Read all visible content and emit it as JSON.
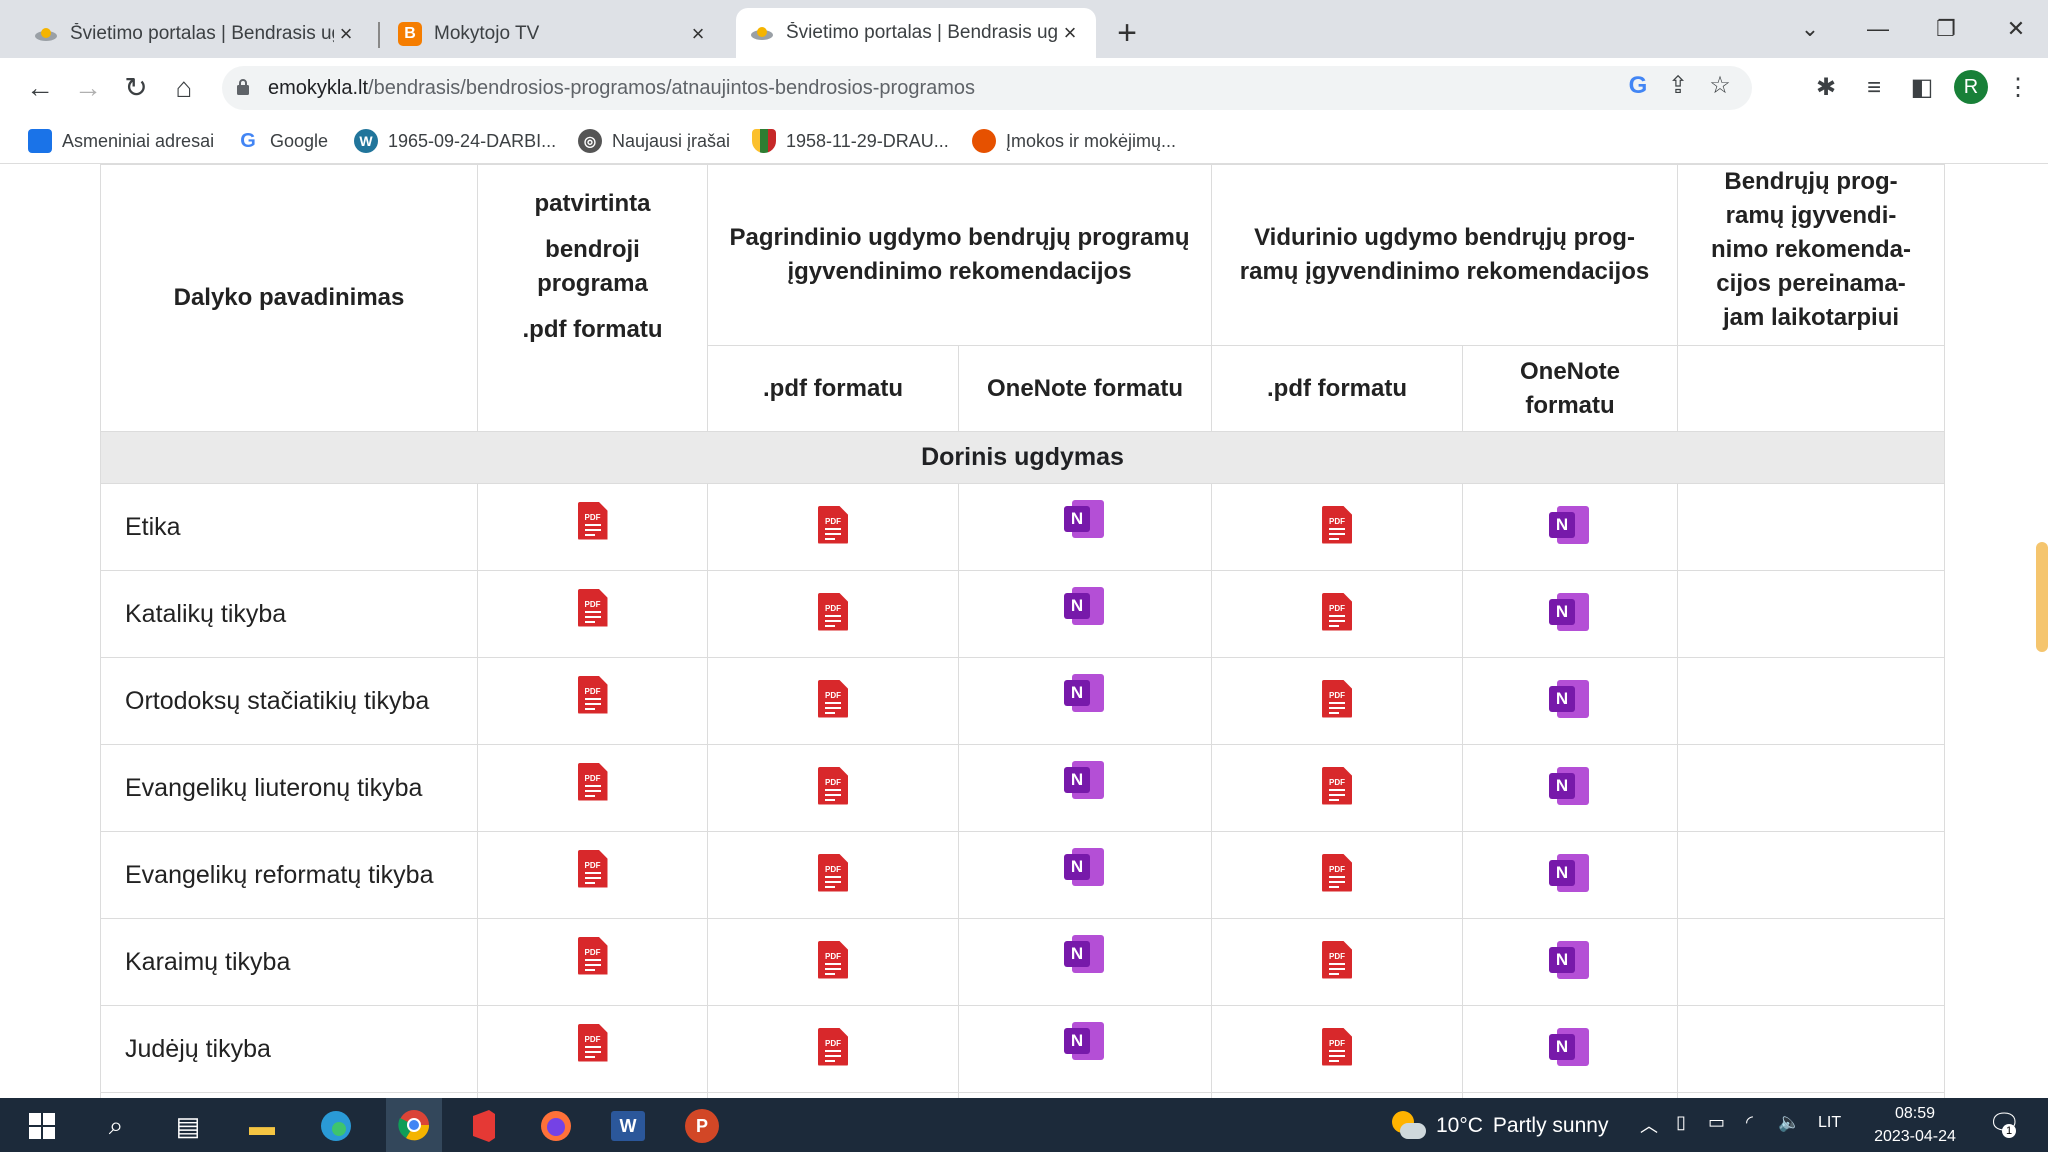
{
  "tabs": [
    {
      "title": "Švietimo portalas | Bendrasis ugd",
      "icon": "portal-icon",
      "active": false
    },
    {
      "title": "Mokytojo TV",
      "icon": "blogger-icon",
      "active": false
    },
    {
      "title": "Švietimo portalas | Bendrasis ugd",
      "icon": "portal-icon",
      "active": true
    }
  ],
  "address": {
    "host": "emokykla.lt",
    "path": "/bendrasis/bendrosios-programos/atnaujintos-bendrosios-programos"
  },
  "bookmarks": [
    {
      "label": "Asmeniniai adresai",
      "icon": "folder-icon",
      "color": "#1a73e8"
    },
    {
      "label": "Google",
      "icon": "google-icon",
      "color": "#4285f4"
    },
    {
      "label": "1965-09-24-DARBI...",
      "icon": "wordpress-icon",
      "color": "#21759b"
    },
    {
      "label": "Naujausi įrašai",
      "icon": "globe-icon",
      "color": "#555"
    },
    {
      "label": "1958-11-29-DRAU...",
      "icon": "shield-icon",
      "color": "#2e7d32"
    },
    {
      "label": "Įmokos ir mokėjimų...",
      "icon": "payments-icon",
      "color": "#e65100"
    }
  ],
  "table": {
    "headers": {
      "subject": "Dalyko pavadinimas",
      "approved": [
        "patvirtinta",
        "bendroji",
        "programa",
        ".pdf formatu"
      ],
      "primary": "Pagrindinio ugdymo bendrųjų programų įgyvendinimo rekomendacijos",
      "secondary": "Vidurinio ugdymo bendrųjų prog-ramų įgyvendinimo rekomendacijos",
      "transitional": [
        "Bendrųjų prog-",
        "ramų įgyvendi-",
        "nimo rekomenda-",
        "cijos pereinama-",
        "jam laikotarpiui"
      ],
      "pdf": ".pdf formatu",
      "onenote": "OneNote formatu",
      "onenote2": [
        "OneNote",
        "formatu"
      ]
    },
    "section": "Dorinis ugdymas",
    "rows": [
      "Etika",
      "Katalikų tikyba",
      "Ortodoksų stačiatikių tikyba",
      "Evangelikų liuteronų tikyba",
      "Evangelikų reformatų tikyba",
      "Karaimų tikyba",
      "Judėjų tikyba"
    ]
  },
  "taskbar": {
    "weather": {
      "temp": "10°C",
      "desc": "Partly sunny"
    },
    "lang": "LIT",
    "time": "08:59",
    "date": "2023-04-24",
    "notifications": "1"
  },
  "profile_initial": "R"
}
